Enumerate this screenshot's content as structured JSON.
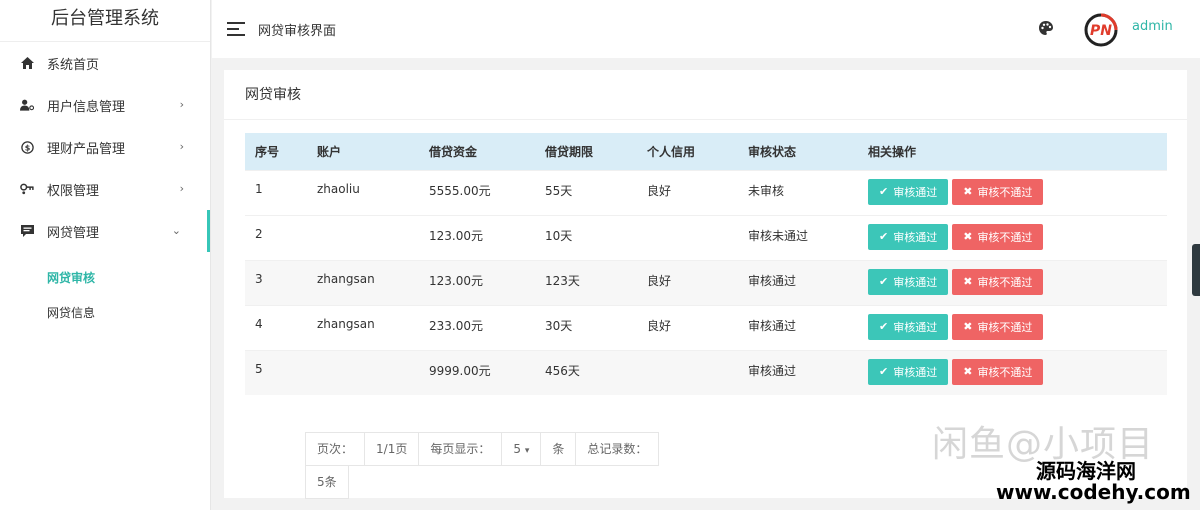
{
  "sidebar": {
    "brand": "后台管理系统",
    "items": [
      {
        "label": "系统首页",
        "icon": "home-icon"
      },
      {
        "label": "用户信息管理",
        "icon": "user-settings-icon",
        "arrow": "›"
      },
      {
        "label": "理财产品管理",
        "icon": "dollar-circle-icon",
        "arrow": "›"
      },
      {
        "label": "权限管理",
        "icon": "key-icon",
        "arrow": "›"
      },
      {
        "label": "网贷管理",
        "icon": "message-icon",
        "arrow": "⌄"
      }
    ],
    "subitems": [
      {
        "label": "网贷审核"
      },
      {
        "label": "网贷信息"
      }
    ]
  },
  "header": {
    "title": "网贷审核界面",
    "user": "admin"
  },
  "panel": {
    "title": "网贷审核",
    "columns": [
      "序号",
      "账户",
      "借贷资金",
      "借贷期限",
      "个人信用",
      "审核状态",
      "相关操作"
    ],
    "rows": [
      {
        "id": "1",
        "account": "zhaoliu",
        "amount": "5555.00元",
        "term": "55天",
        "credit": "良好",
        "status": "未审核"
      },
      {
        "id": "2",
        "account": "",
        "amount": "123.00元",
        "term": "10天",
        "credit": "",
        "status": "审核未通过"
      },
      {
        "id": "3",
        "account": "zhangsan",
        "amount": "123.00元",
        "term": "123天",
        "credit": "良好",
        "status": "审核通过"
      },
      {
        "id": "4",
        "account": "zhangsan",
        "amount": "233.00元",
        "term": "30天",
        "credit": "良好",
        "status": "审核通过"
      },
      {
        "id": "5",
        "account": "",
        "amount": "9999.00元",
        "term": "456天",
        "credit": "",
        "status": "审核通过"
      }
    ],
    "approve_label": "审核通过",
    "reject_label": "审核不通过"
  },
  "pager": {
    "page_label": "页次：",
    "page_value": "1/1页",
    "per_page_label": "每页显示：",
    "per_page_value": "5",
    "unit": "条",
    "total_label": "总记录数：",
    "total_value": "5条"
  },
  "watermark": {
    "line1": "闲鱼@小项目",
    "line2": "源码海洋网",
    "line3": "www.codehy.com"
  },
  "colors": {
    "accent": "#36c6b8",
    "approve": "#3cc6b8",
    "reject": "#ef6464",
    "table_header": "#d9edf7"
  }
}
